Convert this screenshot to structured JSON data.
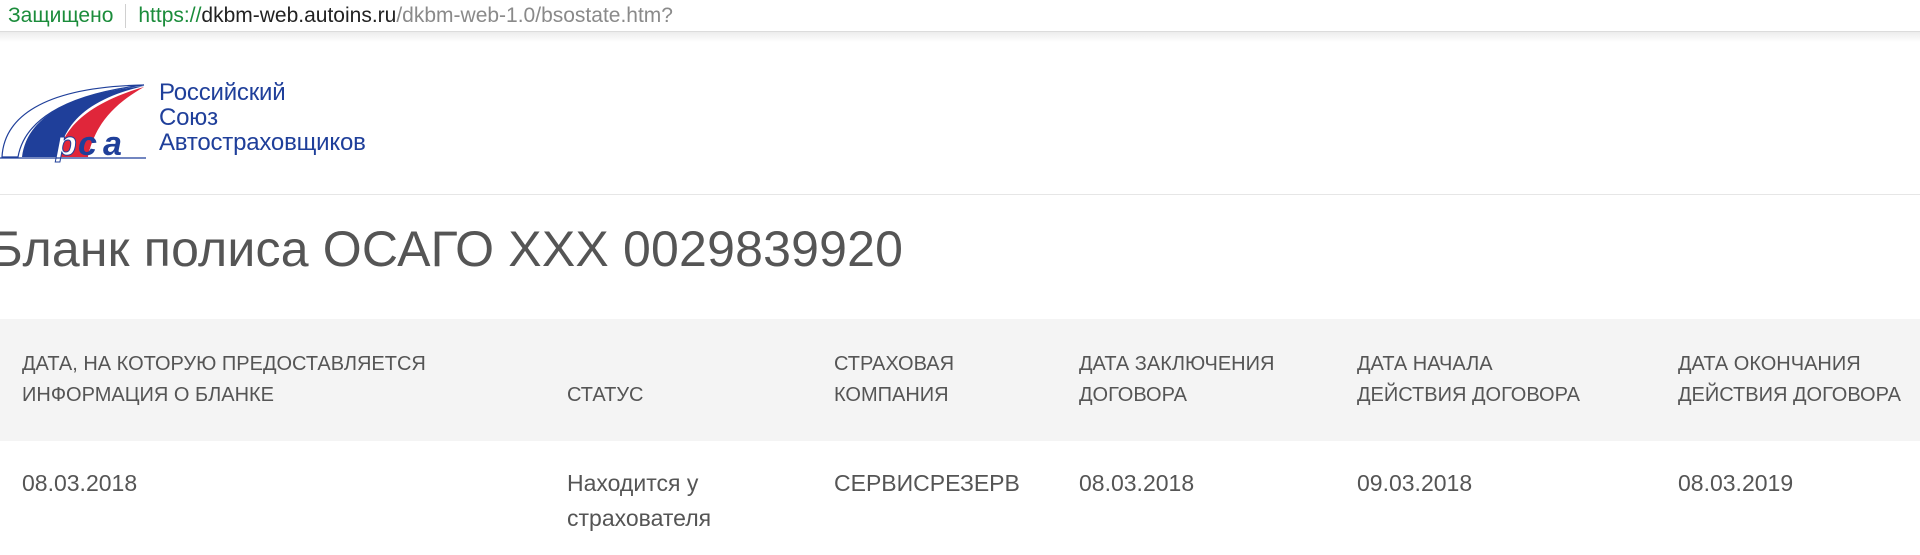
{
  "browser": {
    "secure_label": "Защищено",
    "url_scheme": "https://",
    "url_host": "dkbm-web.autoins.ru",
    "url_path": "/dkbm-web-1.0/bsostate.htm?"
  },
  "logo": {
    "lines": [
      "Российский",
      "Союз",
      "Автостраховщиков"
    ],
    "colors": {
      "blue": "#1f3f9a",
      "red": "#e0263a"
    }
  },
  "page": {
    "title": "Бланк полиса ОСАГО XXX 0029839920"
  },
  "table": {
    "headers": [
      {
        "line1": "ДАТА, НА КОТОРУЮ ПРЕДОСТАВЛЯЕТСЯ",
        "line2": "ИНФОРМАЦИЯ О БЛАНКЕ"
      },
      {
        "line1": "",
        "line2": "СТАТУС"
      },
      {
        "line1": "СТРАХОВАЯ",
        "line2": "КОМПАНИЯ"
      },
      {
        "line1": "ДАТА ЗАКЛЮЧЕНИЯ",
        "line2": "ДОГОВОРА"
      },
      {
        "line1": "ДАТА НАЧАЛА",
        "line2": "ДЕЙСТВИЯ ДОГОВОРА"
      },
      {
        "line1": "ДАТА ОКОНЧАНИЯ",
        "line2": "ДЕЙСТВИЯ ДОГОВОРА"
      }
    ],
    "row": [
      {
        "line1": "08.03.2018",
        "line2": ""
      },
      {
        "line1": "Находится у",
        "line2": "страхователя"
      },
      {
        "line1": "СЕРВИСРЕЗЕРВ",
        "line2": ""
      },
      {
        "line1": "08.03.2018",
        "line2": ""
      },
      {
        "line1": "09.03.2018",
        "line2": ""
      },
      {
        "line1": "08.03.2019",
        "line2": ""
      }
    ]
  }
}
